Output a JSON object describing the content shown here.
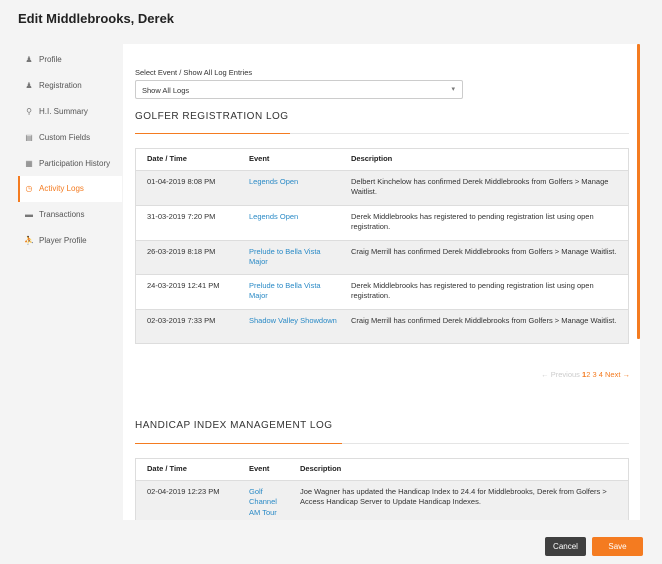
{
  "page_title": "Edit Middlebrooks, Derek",
  "sidebar": {
    "items": [
      {
        "label": "Profile",
        "icon": "person-icon"
      },
      {
        "label": "Registration",
        "icon": "person-icon"
      },
      {
        "label": "H.I. Summary",
        "icon": "location-pin-icon"
      },
      {
        "label": "Custom Fields",
        "icon": "document-icon"
      },
      {
        "label": "Participation History",
        "icon": "calendar-icon"
      },
      {
        "label": "Activity Logs",
        "icon": "clock-icon",
        "active": true
      },
      {
        "label": "Transactions",
        "icon": "credit-card-icon"
      },
      {
        "label": "Player Profile",
        "icon": "golfer-icon"
      }
    ]
  },
  "filter": {
    "label": "Select Event / Show All Log Entries",
    "selected": "Show All Logs"
  },
  "registration_log": {
    "title": "GOLFER REGISTRATION LOG",
    "headers": [
      "Date / Time",
      "Event",
      "Description"
    ],
    "rows": [
      {
        "date": "01-04-2019 8:08 PM",
        "event": "Legends Open",
        "description": "Delbert Kinchelow has confirmed Derek Middlebrooks from Golfers > Manage Waitlist."
      },
      {
        "date": "31-03-2019 7:20 PM",
        "event": "Legends Open",
        "description": "Derek Middlebrooks has registered to pending registration list using open registration."
      },
      {
        "date": "26-03-2019 8:18 PM",
        "event": "Prelude to Bella Vista Major",
        "description": "Craig Merrill has confirmed Derek Middlebrooks from Golfers > Manage Waitlist."
      },
      {
        "date": "24-03-2019 12:41 PM",
        "event": "Prelude to Bella Vista Major",
        "description": "Derek Middlebrooks has registered to pending registration list using open registration."
      },
      {
        "date": "02-03-2019 7:33 PM",
        "event": "Shadow Valley Showdown",
        "description": "Craig Merrill has confirmed Derek Middlebrooks from Golfers > Manage Waitlist."
      }
    ],
    "pagination": {
      "prev": "← Previous",
      "pages": [
        "1",
        "2",
        "3",
        "4"
      ],
      "current": "1",
      "next": "Next →"
    }
  },
  "handicap_log": {
    "title": "HANDICAP INDEX MANAGEMENT LOG",
    "headers": [
      "Date / Time",
      "Event",
      "Description"
    ],
    "rows": [
      {
        "date": "02-04-2019 12:23 PM",
        "event": "Golf Channel AM Tour",
        "description": "Joe Wagner has updated the Handicap Index to 24.4 for Middlebrooks, Derek from Golfers > Access Handicap Server to Update Handicap Indexes."
      }
    ]
  },
  "actions": {
    "cancel": "Cancel",
    "save": "Save"
  },
  "colors": {
    "accent": "#f47b20",
    "link": "#2a8ac6",
    "cancel_bg": "#3f3f3f"
  }
}
